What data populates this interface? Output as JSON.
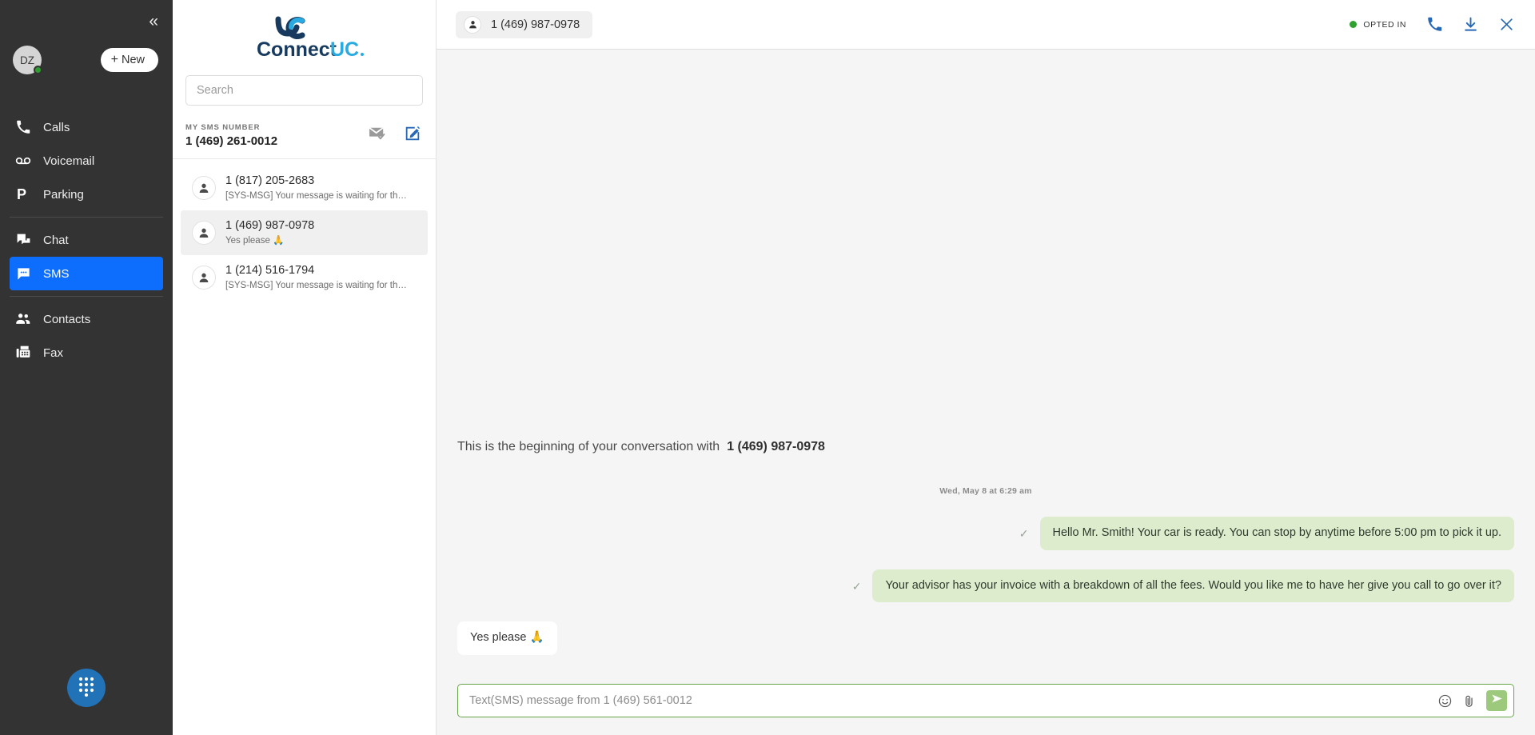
{
  "colors": {
    "nav_bg": "#333333",
    "nav_active": "#0d6efd",
    "brand_dark": "#173a5e",
    "brand_light": "#29abe2",
    "outgoing_bubble": "#ddeccd",
    "incoming_bubble": "#ffffff",
    "send_button": "#9dc97c",
    "composer_border": "#67a447",
    "presence_online": "#2f9e2f",
    "opted_in_dot": "#30a030",
    "dialpad": "#2272b8"
  },
  "navbar": {
    "collapse_icon": "chevron-double-left-icon",
    "avatar_initials": "DZ",
    "presence": "online",
    "new_button_label": "New",
    "new_button_icon": "plus-icon",
    "items": [
      {
        "label": "Calls",
        "icon": "phone-icon",
        "active": false
      },
      {
        "label": "Voicemail",
        "icon": "voicemail-icon",
        "active": false
      },
      {
        "label": "Parking",
        "icon": "parking-p-icon",
        "active": false
      },
      {
        "label": "Chat",
        "icon": "chat-bubbles-icon",
        "active": false
      },
      {
        "label": "SMS",
        "icon": "sms-bubble-icon",
        "active": true
      },
      {
        "label": "Contacts",
        "icon": "contacts-people-icon",
        "active": false
      },
      {
        "label": "Fax",
        "icon": "fax-machine-icon",
        "active": false
      }
    ],
    "dialpad_icon": "dialpad-icon"
  },
  "listpanel": {
    "brand_name_part1": "Connect",
    "brand_name_part2": "UC",
    "brand_mark": "uc-logo-icon",
    "search": {
      "placeholder": "Search",
      "value": ""
    },
    "my_sms_number_label": "MY SMS NUMBER",
    "my_sms_number_value": "1 (469) 261-0012",
    "mark_read_icon": "envelope-check-icon",
    "compose_icon": "compose-pencil-icon",
    "conversations": [
      {
        "avatar_icon": "person-icon",
        "title": "1 (817) 205-2683",
        "preview": "[SYS-MSG] Your message is waiting for the...",
        "selected": false
      },
      {
        "avatar_icon": "person-icon",
        "title": "1 (469) 987-0978",
        "preview": "Yes please 🙏",
        "selected": true
      },
      {
        "avatar_icon": "person-icon",
        "title": "1 (214) 516-1794",
        "preview": "[SYS-MSG] Your message is waiting for the...",
        "selected": false
      }
    ]
  },
  "main": {
    "header": {
      "chip_avatar_icon": "person-icon",
      "chip_label": "1 (469) 987-0978",
      "opted_in_label": "OPTED IN",
      "call_icon": "phone-icon",
      "download_icon": "download-icon",
      "close_icon": "close-x-icon"
    },
    "thread": {
      "beginning_prefix": "This is the beginning of your conversation with",
      "beginning_number": "1 (469) 987-0978",
      "daystamp": "Wed, May 8 at 6:29 am",
      "messages": [
        {
          "direction": "out",
          "status_icon": "check-icon",
          "text": "Hello Mr. Smith! Your car is ready. You can stop by anytime before 5:00 pm to pick it up."
        },
        {
          "direction": "out",
          "status_icon": "check-icon",
          "text": "Your advisor has your invoice with a breakdown of all the fees. Would you like me to have her give you call to go over it?"
        },
        {
          "direction": "in",
          "status_icon": "",
          "text": "Yes please 🙏"
        }
      ]
    },
    "composer": {
      "placeholder": "Text(SMS) message from 1 (469) 561-0012",
      "value": "",
      "emoji_icon": "emoji-smiley-icon",
      "attach_icon": "paperclip-icon",
      "send_icon": "send-paper-plane-icon"
    }
  }
}
